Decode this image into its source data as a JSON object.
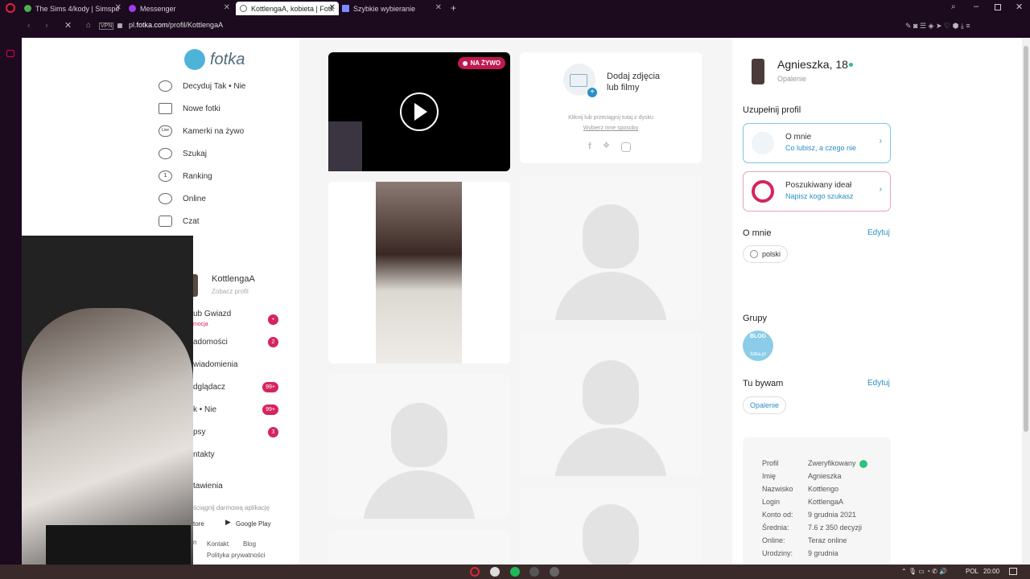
{
  "browser": {
    "tabs": [
      {
        "label": "The Sims 4/kody | Simspe",
        "active": false
      },
      {
        "label": "Messenger",
        "active": false
      },
      {
        "label": "KottlengaA, kobieta | Fotk",
        "active": true
      },
      {
        "label": "Szybkie wybieranie",
        "active": false
      }
    ],
    "url_prefix": "pl.",
    "url_domain": "fotka.com",
    "url_path": "/profil/KottlengaA",
    "vpn_label": "VPN"
  },
  "logo": {
    "text": "fotka"
  },
  "left_nav": {
    "items": [
      {
        "label": "Decyduj Tak • Nie",
        "icon": "heart-icon"
      },
      {
        "label": "Nowe fotki",
        "icon": "image-icon"
      },
      {
        "label": "Kamerki na żywo",
        "icon": "live-icon",
        "icon_text": "Live"
      },
      {
        "label": "Szukaj",
        "icon": "search-icon"
      },
      {
        "label": "Ranking",
        "icon": "ranking-icon",
        "icon_text": "1"
      },
      {
        "label": "Online",
        "icon": "online-icon"
      },
      {
        "label": "Czat",
        "icon": "chat-icon"
      }
    ],
    "user_name": "KottlengaA",
    "user_sub": "Zobacz profil",
    "user_items": [
      {
        "label": "ub Gwiazd",
        "sub": "mocja",
        "badge": "•"
      },
      {
        "label": "adomości",
        "badge": "2"
      },
      {
        "label": "wiadomienia",
        "badge": ""
      },
      {
        "label": "dglądacz",
        "badge": "99+"
      },
      {
        "label": "k • Nie",
        "badge": "99+"
      },
      {
        "label": "psy",
        "badge": "3"
      },
      {
        "label": "ntakty",
        "badge": ""
      }
    ],
    "settings_label": "tawienia",
    "app_promo": "ściągnij darmową aplikację",
    "store_left": "tore",
    "google_play": "Google Play",
    "footer_links": [
      "Kontakt",
      "Blog"
    ],
    "footer_privacy": "Polityka prywatności",
    "footer_left": "n"
  },
  "live_card": {
    "badge": "NA ŻYWO"
  },
  "upload_card": {
    "title_line1": "Dodaj zdjęcia",
    "title_line2": "lub filmy",
    "hint": "Kliknij lub przeciągnij tutaj z dysku",
    "other_ways": "Wybierz inne sposoby"
  },
  "profile": {
    "name": "Agnieszka, 18",
    "location": "Opalenie",
    "complete_title": "Uzupełnij profil",
    "about_card_title": "O mnie",
    "about_card_sub": "Co lubisz, a czego nie",
    "ideal_card_title": "Poszukiwany ideał",
    "ideal_card_sub": "Napisz kogo szukasz",
    "about_heading": "O mnie",
    "edit_label": "Edytuj",
    "language_chip": "polski",
    "groups_heading": "Grupy",
    "group_badge_text": "BLOG",
    "group_badge_sub": "fotka.pl",
    "tu_bywam_heading": "Tu bywam",
    "tu_bywam_edit": "Edytuj",
    "place_chip": "Opalenie",
    "info": [
      {
        "key": "Profil",
        "value": "Zweryfikowany"
      },
      {
        "key": "Imię",
        "value": "Agnieszka"
      },
      {
        "key": "Nazwisko",
        "value": "Kottlengo"
      },
      {
        "key": "Login",
        "value": "KottlengaA"
      },
      {
        "key": "Konto od:",
        "value": "9 grudnia 2021"
      },
      {
        "key": "Średnia:",
        "value": "7.6 z 350 decyzji"
      },
      {
        "key": "Online:",
        "value": "Teraz online"
      },
      {
        "key": "Urodziny:",
        "value": "9 grudnia"
      }
    ]
  },
  "taskbar": {
    "language": "POL",
    "time": "20:00"
  },
  "colors": {
    "accent_pink": "#d6245c",
    "accent_blue": "#2b8fc7",
    "browser_dark": "#1c0a1f"
  }
}
